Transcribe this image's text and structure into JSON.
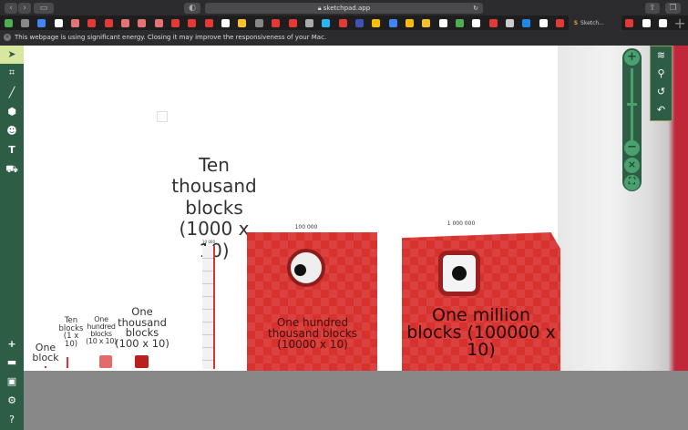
{
  "browser": {
    "url": "sketchpad.app",
    "active_tab": "Sketch...",
    "energy_warning": "This webpage is using significant energy. Closing it may improve the responsiveness of your Mac.",
    "favicon_colors": [
      "#4caf50",
      "#888",
      "#4285f4",
      "#fff",
      "#e57373",
      "#e53935",
      "#e53935",
      "#e57373",
      "#e57373",
      "#e57373",
      "#e53935",
      "#e53935",
      "#e53935",
      "#fff",
      "#fbc02d",
      "#888",
      "#e53935",
      "#e53935",
      "#aaa",
      "#29b6f6",
      "#e53935",
      "#3f51b5",
      "#fbbc04",
      "#4285f4",
      "#fbbc04",
      "#f6c026",
      "#fff",
      "#4caf50",
      "#fff",
      "#e53935",
      "#ccc",
      "#1e88e5",
      "#fff",
      "#e53935"
    ],
    "favicon_colors_after": [
      "#e53935",
      "#fff",
      "#fff"
    ]
  },
  "sidebar": {
    "tools": [
      "select-icon",
      "crop-icon",
      "pen-icon",
      "shape-icon",
      "sticker-icon",
      "text-icon",
      "fill-icon"
    ],
    "bottom": [
      "add-icon",
      "folder-icon",
      "save-icon",
      "settings-icon",
      "help-icon"
    ]
  },
  "canvas": {
    "labels": {
      "one": "One block",
      "ten": "Ten blocks (1 x 10)",
      "hundred": "One hundred blocks (10 x 10)",
      "thousand": "One thousand blocks (100 x 10)",
      "ten_thousand": "Ten thousand blocks (1000 x 10)",
      "hundred_thousand": "One hundred thousand blocks (10000 x 10)",
      "million": "One million blocks (100000 x 10)"
    },
    "numbers": {
      "ten_thousand": "10 000",
      "hundred_thousand": "100 000",
      "million": "1 000 000"
    }
  },
  "zoom_controls": {
    "in": "+",
    "out": "−",
    "reset": "×",
    "fit": "⛶",
    "level": 0.5
  },
  "menu": [
    "layers-icon",
    "search-icon",
    "history-icon",
    "undo-icon"
  ]
}
